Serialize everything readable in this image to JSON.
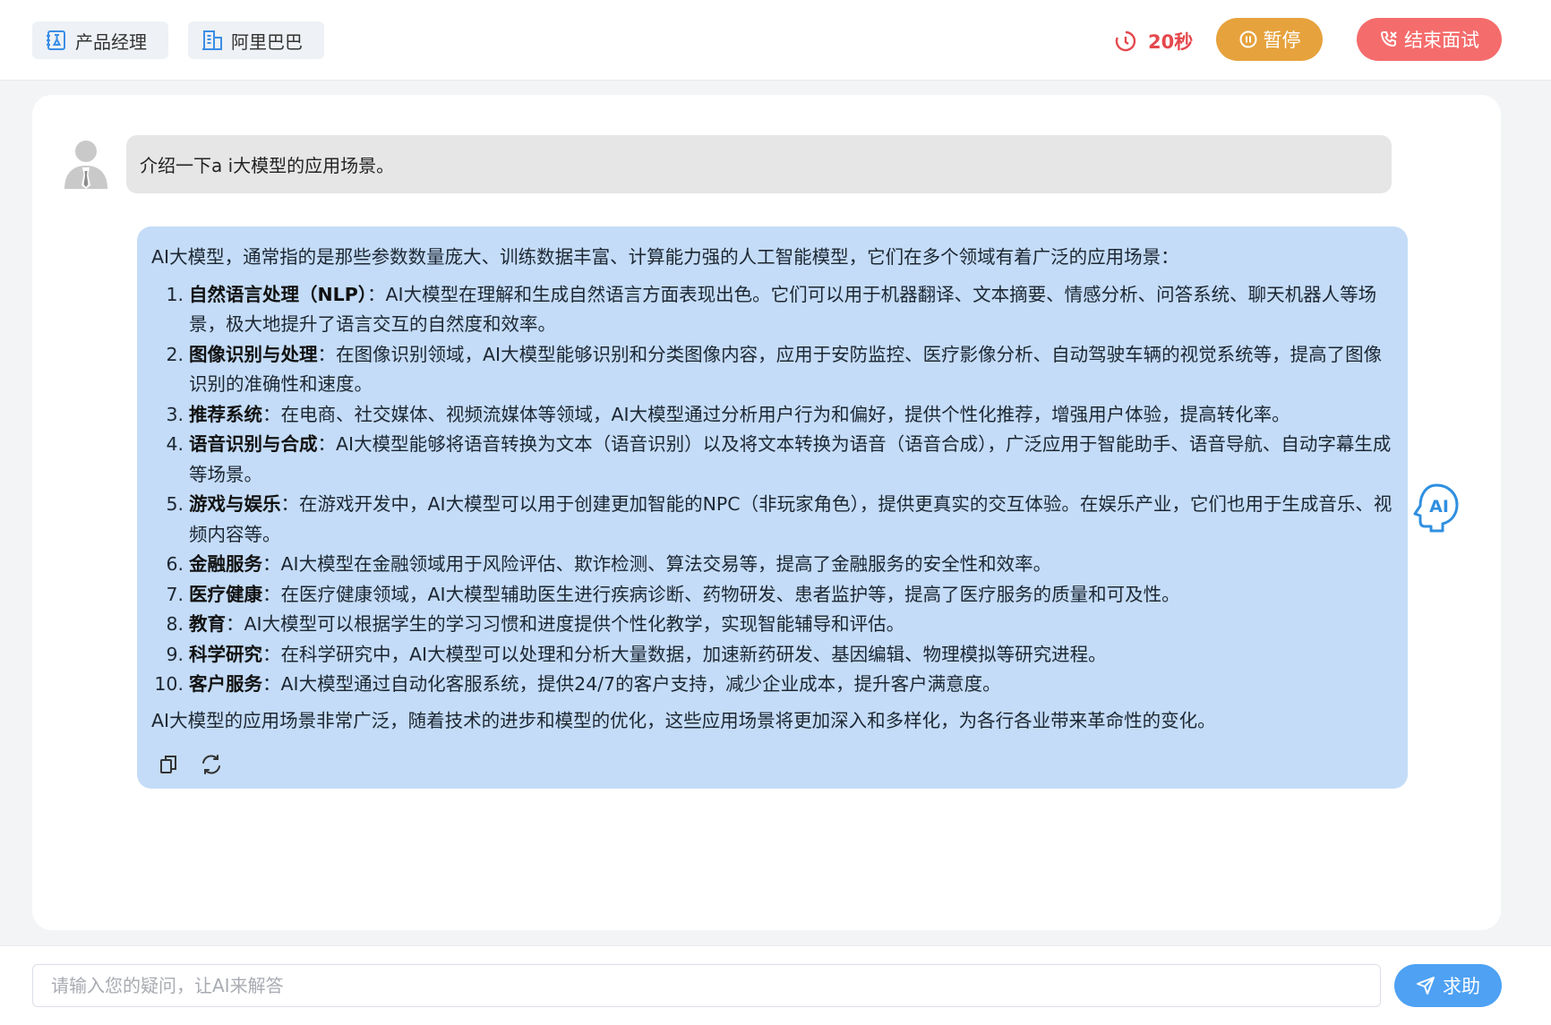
{
  "header": {
    "role_label": "产品经理",
    "company_label": "阿里巴巴",
    "timer_text": "20秒",
    "pause_label": "暂停",
    "end_label": "结束面试"
  },
  "chat": {
    "user_message": "介绍一下a i大模型的应用场景。",
    "ai_intro": "AI大模型，通常指的是那些参数数量庞大、训练数据丰富、计算能力强的人工智能模型，它们在多个领域有着广泛的应用场景：",
    "ai_items": [
      {
        "num": "1.",
        "title": "自然语言处理（NLP）",
        "text": "：AI大模型在理解和生成自然语言方面表现出色。它们可以用于机器翻译、文本摘要、情感分析、问答系统、聊天机器人等场景，极大地提升了语言交互的自然度和效率。"
      },
      {
        "num": "2.",
        "title": "图像识别与处理",
        "text": "：在图像识别领域，AI大模型能够识别和分类图像内容，应用于安防监控、医疗影像分析、自动驾驶车辆的视觉系统等，提高了图像识别的准确性和速度。"
      },
      {
        "num": "3.",
        "title": "推荐系统",
        "text": "：在电商、社交媒体、视频流媒体等领域，AI大模型通过分析用户行为和偏好，提供个性化推荐，增强用户体验，提高转化率。"
      },
      {
        "num": "4.",
        "title": "语音识别与合成",
        "text": "：AI大模型能够将语音转换为文本（语音识别）以及将文本转换为语音（语音合成），广泛应用于智能助手、语音导航、自动字幕生成等场景。"
      },
      {
        "num": "5.",
        "title": "游戏与娱乐",
        "text": "：在游戏开发中，AI大模型可以用于创建更加智能的NPC（非玩家角色），提供更真实的交互体验。在娱乐产业，它们也用于生成音乐、视频内容等。"
      },
      {
        "num": "6.",
        "title": "金融服务",
        "text": "：AI大模型在金融领域用于风险评估、欺诈检测、算法交易等，提高了金融服务的安全性和效率。"
      },
      {
        "num": "7.",
        "title": "医疗健康",
        "text": "：在医疗健康领域，AI大模型辅助医生进行疾病诊断、药物研发、患者监护等，提高了医疗服务的质量和可及性。"
      },
      {
        "num": "8.",
        "title": "教育",
        "text": "：AI大模型可以根据学生的学习习惯和进度提供个性化教学，实现智能辅导和评估。"
      },
      {
        "num": "9.",
        "title": "科学研究",
        "text": "：在科学研究中，AI大模型可以处理和分析大量数据，加速新药研发、基因编辑、物理模拟等研究进程。"
      },
      {
        "num": "10.",
        "title": "客户服务",
        "text": "：AI大模型通过自动化客服系统，提供24/7的客户支持，减少企业成本，提升客户满意度。"
      }
    ],
    "ai_outro": "AI大模型的应用场景非常广泛，随着技术的进步和模型的优化，这些应用场景将更加深入和多样化，为各行各业带来革命性的变化。",
    "ai_avatar_text": "AI"
  },
  "input": {
    "placeholder": "请输入您的疑问，让AI来解答",
    "value": "",
    "ask_label": "求助"
  },
  "colors": {
    "accent_blue": "#4ea1f3",
    "pause_orange": "#e6a23c",
    "end_red": "#f56c6c",
    "timer_red": "#e5484d",
    "ai_bubble": "#c4dcf7",
    "user_bubble": "#e6e6e6"
  },
  "icons": {
    "role": "badge-icon",
    "company": "building-icon",
    "timer": "clock-icon",
    "pause": "pause-circle-icon",
    "end": "phone-hangup-icon",
    "copy": "copy-icon",
    "regenerate": "refresh-icon",
    "ask": "send-icon"
  }
}
